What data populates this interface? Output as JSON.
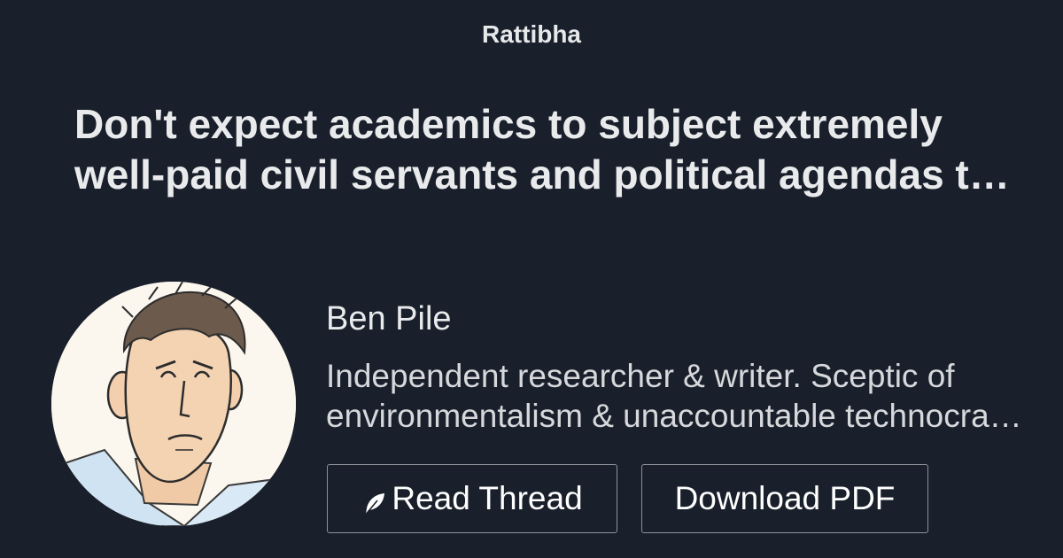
{
  "brand": "Rattibha",
  "thread": {
    "title": "Don't expect academics to subject extremely well-paid civil servants and political agendas to scrutiny. Thread."
  },
  "author": {
    "name": "Ben Pile",
    "bio": "Independent researcher & writer. Sceptic of environmentalism & unaccountable technocratic rule."
  },
  "actions": {
    "read_label": "Read Thread",
    "read_icon": "feather-icon",
    "download_label": "Download PDF"
  },
  "colors": {
    "background": "#19202b",
    "text": "#e6e8ea",
    "button_border": "#8d9399"
  }
}
